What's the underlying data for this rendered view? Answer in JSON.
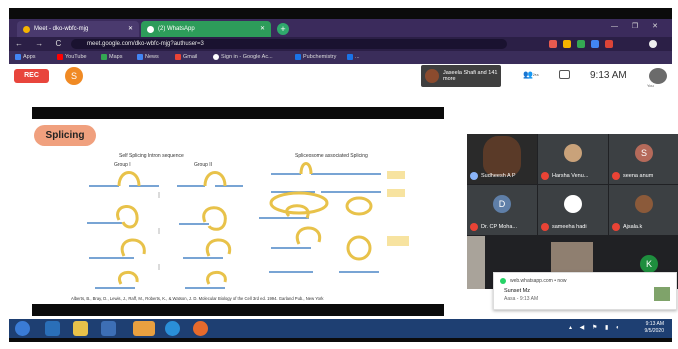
{
  "browser": {
    "tabs": [
      {
        "label": "Meet - dko-wbfc-mjg"
      },
      {
        "label": "(2) WhatsApp"
      }
    ],
    "new_tab": "+",
    "window_controls": "— ❐ ✕",
    "nav": "← → C",
    "url": "meet.google.com/dko-wbfc-mjg?authuser=3",
    "bookmarks": [
      "Apps",
      "YouTube",
      "Maps",
      "News",
      "Gmail",
      "Sign in - Google Ac...",
      "Pubchemistry",
      "..."
    ]
  },
  "meet": {
    "rec_label": "REC",
    "self_initial": "S",
    "participants_label": "Jaseela Shafi and 141 more",
    "participants_count": "²⁵⁶",
    "time": "9:13 AM",
    "you_label": "You"
  },
  "slide": {
    "title": "Splicing",
    "left_heading": "Self Splicing Intron sequence",
    "group1": "Group I",
    "group2": "Group II",
    "right_heading": "Spliceosome associated Splicing",
    "citation": "Alberts, B., Bray, D., Lewis, J., Raff, M., Roberts, K., & Watson, J. D. Molecular Biology of the Cell 3rd ed. 1994. Garland Pub., New York"
  },
  "tiles": [
    {
      "name": "Sudheesh A P",
      "initial": "",
      "color": "#5a3a28"
    },
    {
      "name": "Harsha Venu...",
      "initial": "",
      "color": "#c9a27a"
    },
    {
      "name": "seena anum",
      "initial": "S",
      "color": "#b56a5a"
    },
    {
      "name": "Dr. CP Moha...",
      "initial": "D",
      "color": "#5f7fa8"
    },
    {
      "name": "sameeha hadi",
      "initial": "",
      "color": "#ffffff"
    },
    {
      "name": "Ajsala.k",
      "initial": "",
      "color": "#8b5a3a"
    }
  ],
  "notification": {
    "source": "web.whatsapp.com • now",
    "title": "Sunset Mz",
    "body": "Aasa - 9:13 AM"
  },
  "k_initial": "K",
  "taskbar": {
    "tray_time": "9:13 AM",
    "tray_date": "9/5/2020"
  },
  "colors": {
    "rec": "#e8453c",
    "splicing_badge": "#f0a07e",
    "taskbar": "#1e3f72",
    "whatsapp_tab": "#2d9c5a"
  }
}
